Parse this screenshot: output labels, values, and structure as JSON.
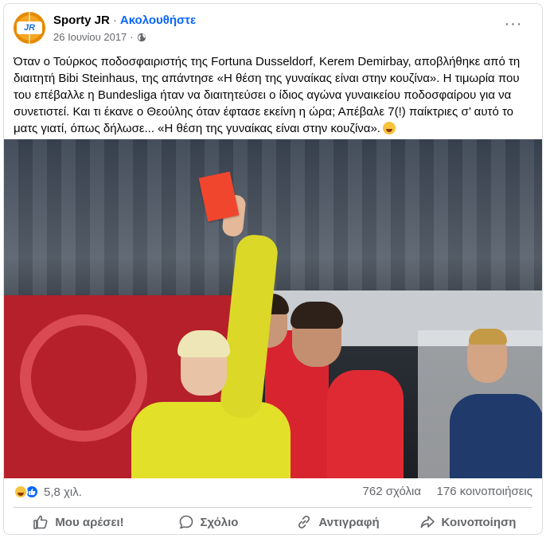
{
  "post": {
    "page_name": "Sporty JR",
    "separator": "·",
    "follow_label": "Ακολουθήστε",
    "date": "26 Ιουνίου 2017",
    "privacy_icon": "globe-icon",
    "more_icon": "more-options-icon",
    "more_label": "···",
    "avatar_text": "JR",
    "text": "Όταν ο Τούρκος ποδοσφαιριστής της Fortuna Dusseldorf, Kerem Demirbay, αποβλήθηκε από τη διαιτητή Bibi Steinhaus, της απάντησε «Η θέση της γυναίκας είναι στην κουζίνα». Η τιμωρία που του επέβαλλε η Bundesliga ήταν να διαιτητεύσει ο ίδιος αγώνα γυναικείου ποδοσφαίρου για να συνετιστεί. Και τι έκανε ο Θεούλης όταν έφτασε εκείνη η ώρα; Απέβαλε 7(!) παίκτριες σ’ αυτό το ματς γιατί, όπως δήλωσε... «Η θέση της γυναίκας είναι στην κουζίνα».",
    "text_emoji": "laughing-emoji"
  },
  "stats": {
    "reaction_icons": [
      "haha-reaction-icon",
      "like-reaction-icon"
    ],
    "reactions_count": "5,8 χιλ.",
    "comments_count": "762 σχόλια",
    "shares_count": "176 κοινοποιήσεις"
  },
  "actions": {
    "like_label": "Μου αρέσει!",
    "comment_label": "Σχόλιο",
    "copy_label": "Αντιγραφή",
    "share_label": "Κοινοποίηση"
  },
  "colors": {
    "accent": "#0866ff",
    "secondary_text": "#65676b",
    "divider": "#ced0d4"
  }
}
